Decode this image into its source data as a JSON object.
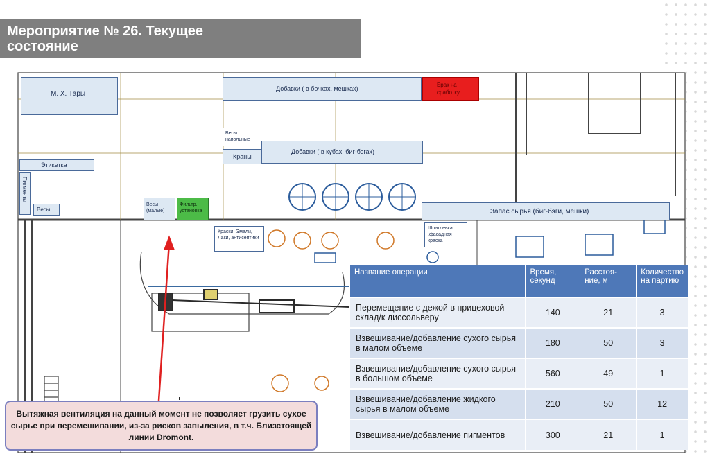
{
  "slide_title": "Мероприятие № 26. Текущее состояние",
  "plan_labels": {
    "mx_tary": "М. Х. Тары",
    "dobavki_bags": "Добавки ( в бочках, мешках)",
    "brak": "Брак на сработку",
    "vesy_napolnye": "Весы напольные",
    "krany": "Краны",
    "dobavki_kub": "Добавки  ( в кубах, биг-бэгах)",
    "etiketka": "Этикетка",
    "pigmenty": "Пигменты",
    "vesy": "Весы",
    "vesy_malye": "Весы (малые)",
    "filtr": "Фильтр. установка",
    "zapas": "Запас сырья (биг-бэги, мешки)",
    "kraski": "Краски, Эмали, Лаки, антисептики",
    "shpatlevka": "Шпатлевка ,фасадная краска"
  },
  "table": {
    "headers": [
      "Название операции",
      "Время, секунд",
      "Расстоя-ние, м",
      "Количество на партию"
    ],
    "rows": [
      {
        "op": "Перемещение с дежой в прицеховой склад/к диссольверу",
        "time": "140",
        "dist": "21",
        "qty": "3"
      },
      {
        "op": "Взвешивание/добавление сухого сырья в малом объеме",
        "time": "180",
        "dist": "50",
        "qty": "3"
      },
      {
        "op": "Взвешивание/добавление сухого сырья в большом объеме",
        "time": "560",
        "dist": "49",
        "qty": "1"
      },
      {
        "op": "Взвешивание/добавление жидкого сырья в малом объеме",
        "time": "210",
        "dist": "50",
        "qty": "12"
      },
      {
        "op": "Взвешивание/добавление пигментов",
        "time": "300",
        "dist": "21",
        "qty": "1"
      }
    ]
  },
  "callout": "Вытяжная вентиляция на данный момент не позволяет грузить сухое сырье при перемешивании, из-за рисков запыления, в т.ч. Близстоящей линии Dromont.",
  "colors": {
    "title_bg": "#7f7f7f",
    "table_header": "#4e78b8",
    "arrow": "#e02020",
    "brak": "#e81e1e",
    "filtr": "#4cbb47"
  }
}
